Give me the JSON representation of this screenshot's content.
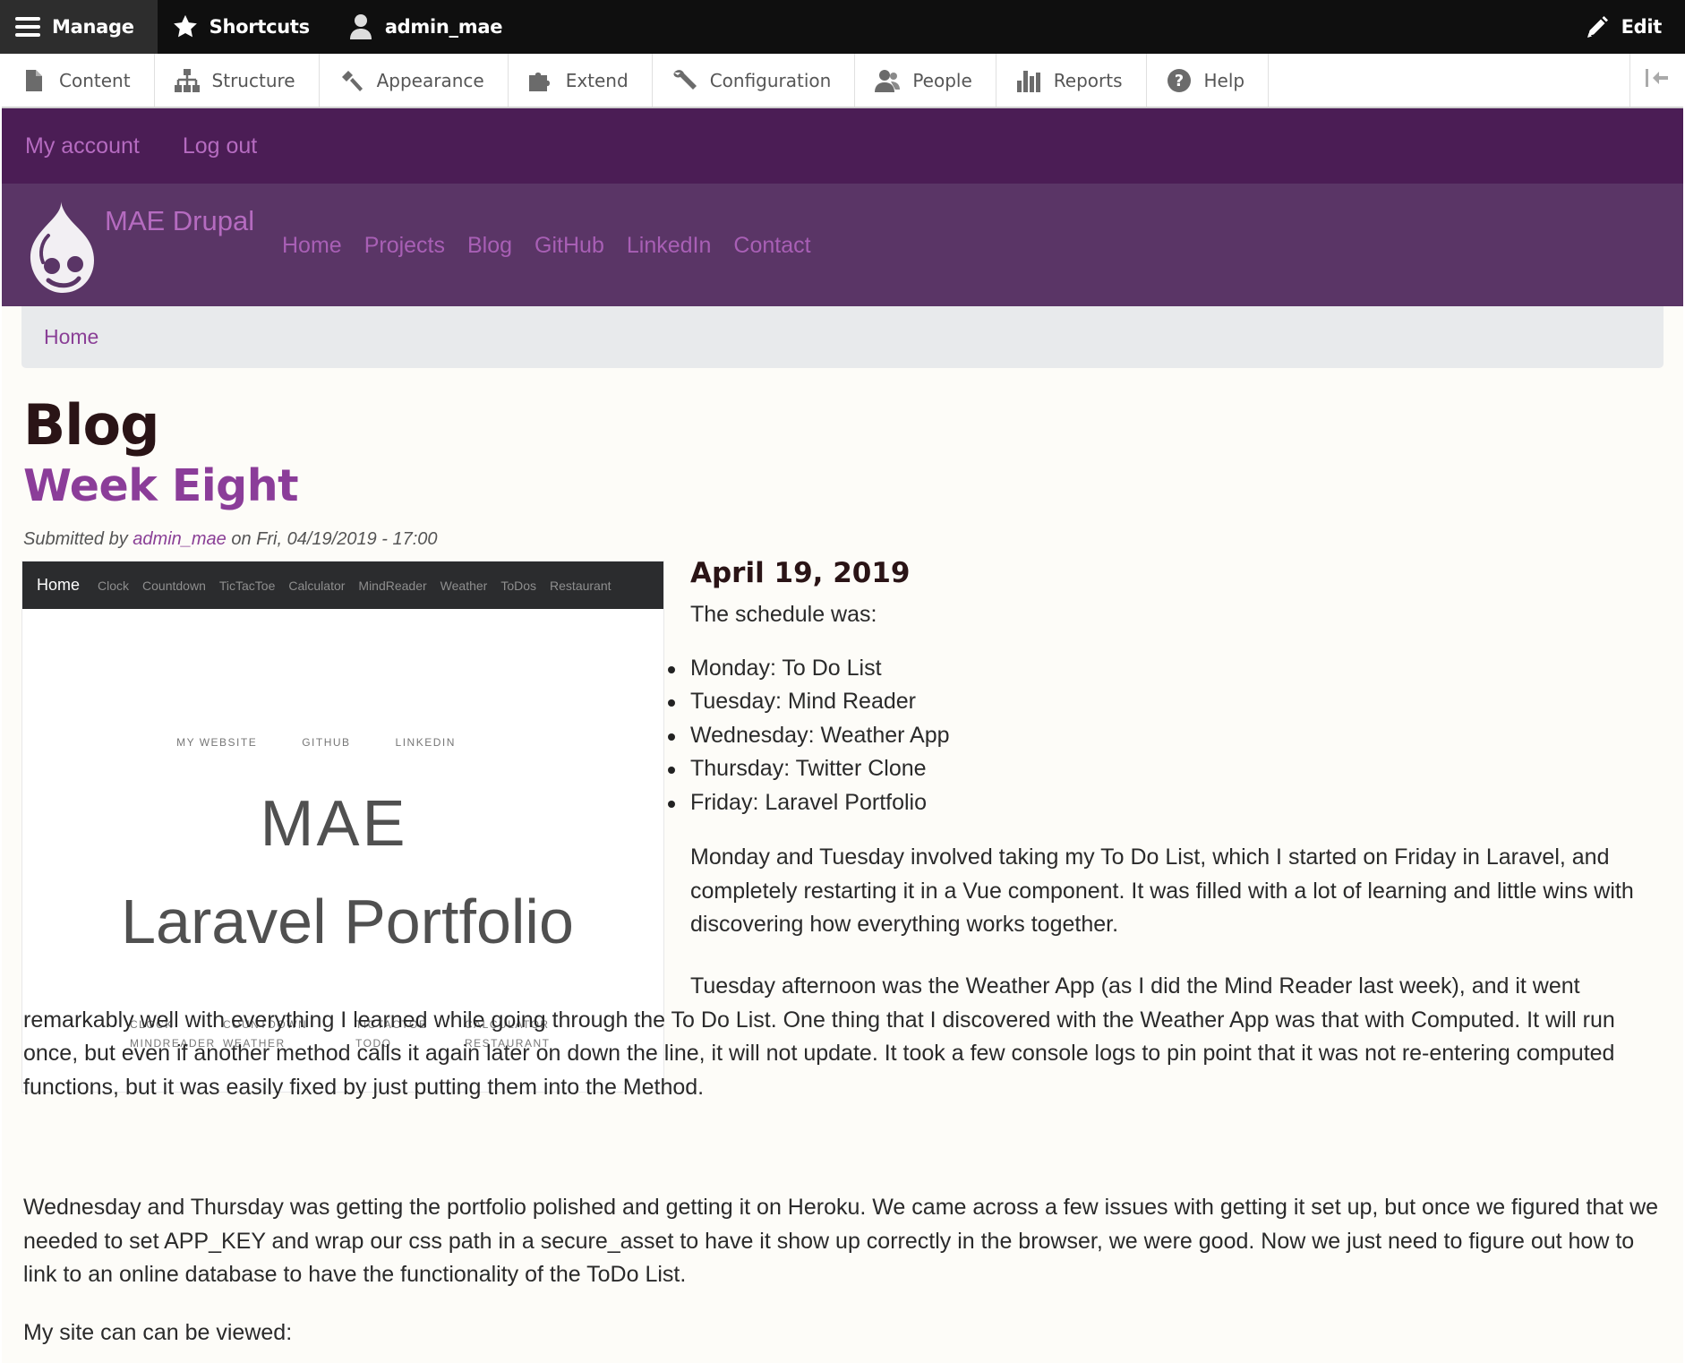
{
  "toolbar": {
    "manage": "Manage",
    "shortcuts": "Shortcuts",
    "user": "admin_mae",
    "edit": "Edit"
  },
  "tray": [
    {
      "label": "Content",
      "icon": "file-icon"
    },
    {
      "label": "Structure",
      "icon": "sitemap-icon"
    },
    {
      "label": "Appearance",
      "icon": "paint-brush-icon"
    },
    {
      "label": "Extend",
      "icon": "puzzle-icon"
    },
    {
      "label": "Configuration",
      "icon": "wrench-icon"
    },
    {
      "label": "People",
      "icon": "people-icon"
    },
    {
      "label": "Reports",
      "icon": "bar-chart-icon"
    },
    {
      "label": "Help",
      "icon": "help-icon"
    }
  ],
  "secondary_menu": {
    "my_account": "My account",
    "log_out": "Log out"
  },
  "branding": {
    "site_name": "MAE Drupal",
    "nav": [
      "Home",
      "Projects",
      "Blog",
      "GitHub",
      "LinkedIn",
      "Contact"
    ]
  },
  "breadcrumb": {
    "home": "Home"
  },
  "page": {
    "title": "Blog",
    "node_title": "Week Eight",
    "submitted_prefix": "Submitted by ",
    "author": "admin_mae",
    "submitted_suffix": " on Fri, 04/19/2019 - 17:00"
  },
  "article_image": {
    "nav_home": "Home",
    "nav_links": [
      "Clock",
      "Countdown",
      "TicTacToe",
      "Calculator",
      "MindReader",
      "Weather",
      "ToDos",
      "Restaurant"
    ],
    "top_links": [
      "MY WEBSITE",
      "GITHUB",
      "LINKEDIN"
    ],
    "heading1": "MAE",
    "heading2": "Laravel Portfolio",
    "app_links": [
      "CLOCK",
      "COUNTDOWN",
      "TICTACTOE",
      "CALCULATOR",
      "MINDREADER",
      "WEATHER",
      "TODO",
      "RESTAURANT"
    ]
  },
  "body": {
    "date": "April 19, 2019",
    "schedule_intro": "The schedule was:",
    "schedule": [
      "Monday: To Do List",
      "Tuesday: Mind Reader",
      "Wednesday: Weather App",
      "Thursday: Twitter Clone",
      "Friday: Laravel Portfolio"
    ],
    "para_monday": "Monday and Tuesday involved taking my To Do List, which I started on Friday in Laravel, and completely restarting it in a Vue component. It was filled with a lot of learning and little wins with discovering how everything works together.",
    "para_tuesday": "Tuesday afternoon was the Weather App (as I did the Mind Reader last week), and it went remarkably well with everything I learned while going through the To Do List. One thing that I discovered with the Weather App was that with Computed. It will run once, but even if another method calls it again later on down the line, it will not update. It took a few console logs to pin point that it was not re-entering computed functions, but it was easily fixed by just putting them into the Method.",
    "para_wednesday": "Wednesday and Thursday was getting the portfolio polished and getting it on Heroku. We came across a few issues with getting it set up, but once we figured that we needed to set APP_KEY and wrap our css path in a secure_asset to have it show up correctly in the browser, we were good. Now we just need to figure out how to link to an online database to have the functionality of the ToDo List.",
    "para_site": "My site can can be viewed:"
  },
  "colors": {
    "toolbar_bg": "#0f0f0f",
    "secondary_bg": "#4b1d55",
    "branding_bg": "#5a3566",
    "link_purple": "#8a3f96",
    "content_bg": "#fdfcf8"
  }
}
